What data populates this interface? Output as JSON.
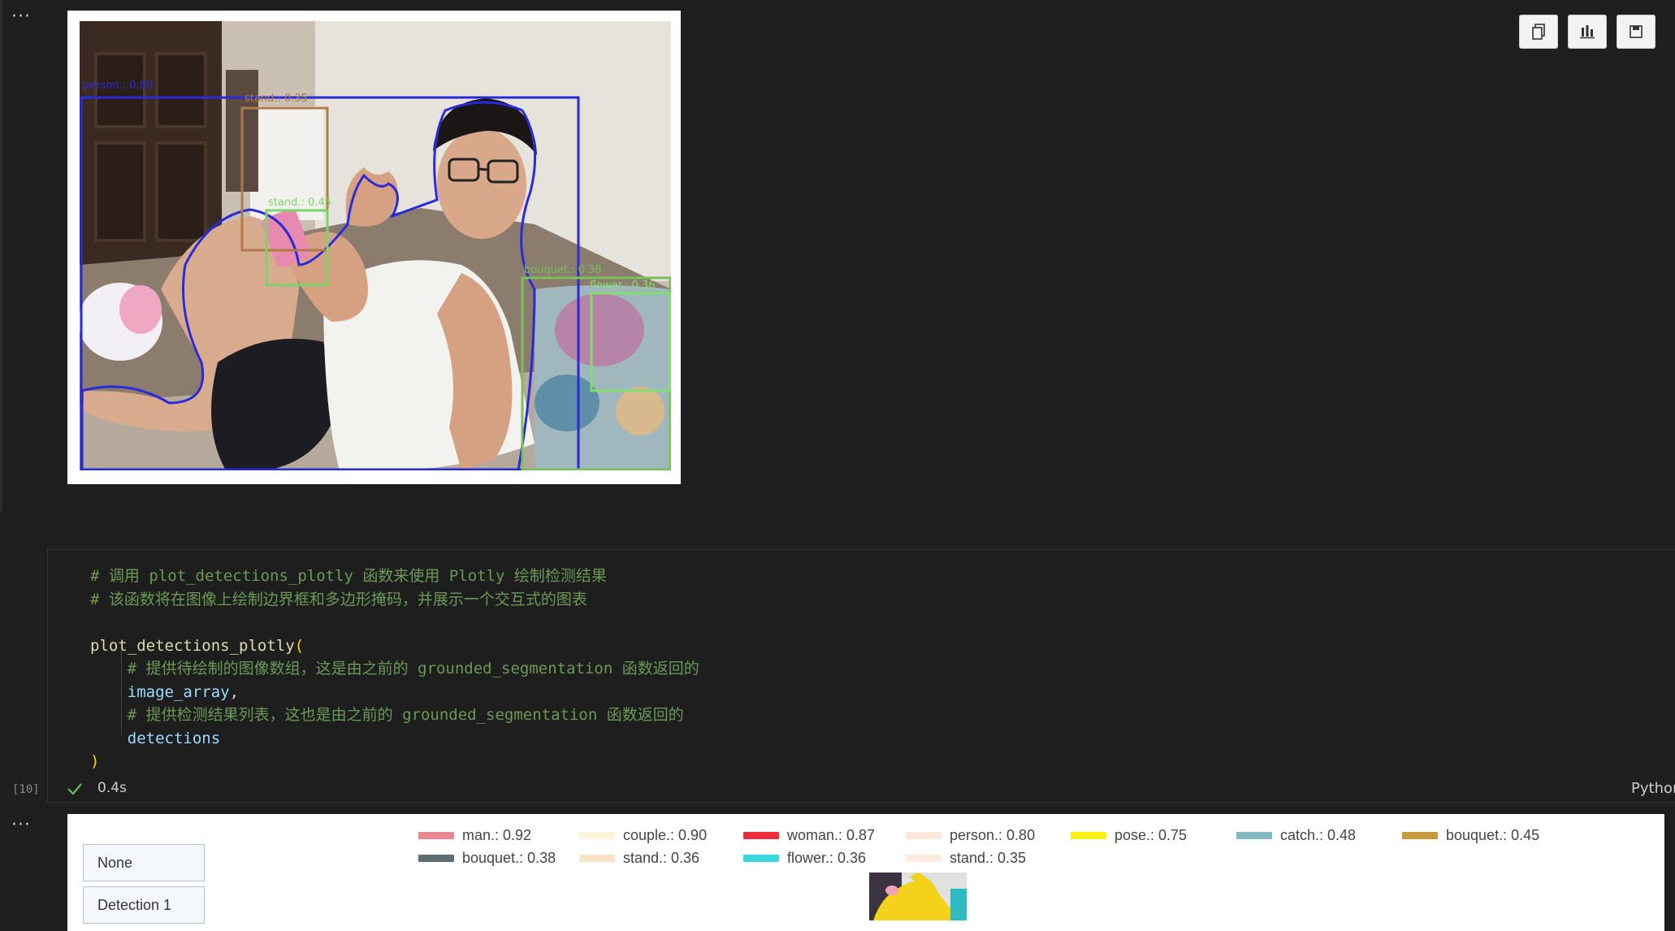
{
  "top_output": {
    "more_label": "···",
    "detections": [
      {
        "label": "person.: 0.80",
        "color": "#2a2ad9"
      },
      {
        "label": "stand.: 0.35",
        "color": "#b07a4a"
      },
      {
        "label": "stand.: 0.45",
        "color": "#7bd36a"
      },
      {
        "label": "bouquet.: 0.38",
        "color": "#7bbf5a"
      },
      {
        "label": "flower.: 0.36",
        "color": "#82dd6c"
      }
    ],
    "toolbar": [
      {
        "name": "copy-icon"
      },
      {
        "name": "bar-chart-icon"
      },
      {
        "name": "save-icon"
      }
    ]
  },
  "code_cell": {
    "lines": [
      {
        "comment": "# 调用 plot_detections_plotly 函数来使用 Plotly 绘制检测结果"
      },
      {
        "comment": "# 该函数将在图像上绘制边界框和多边形掩码，并展示一个交互式的图表"
      },
      {
        "blank": ""
      },
      {
        "fn": "plot_detections_plotly",
        "paren": "("
      },
      {
        "comment": "    # 提供待绘制的图像数组，这是由之前的 grounded_segmentation 函数返回的"
      },
      {
        "var": "    image_array",
        "punct": ","
      },
      {
        "comment": "    # 提供检测结果列表，这也是由之前的 grounded_segmentation 函数返回的"
      },
      {
        "var": "    detections"
      },
      {
        "paren": ")"
      }
    ],
    "execution_count": "[10]",
    "status_time": "0.4s",
    "language": "Python"
  },
  "bottom_output": {
    "more_label": "···",
    "buttons": [
      "None",
      "Detection 1"
    ],
    "legend": [
      {
        "label": "man.: 0.92",
        "color": "#e8878f"
      },
      {
        "label": "couple.: 0.90",
        "color": "#fdf6dc"
      },
      {
        "label": "woman.: 0.87",
        "color": "#ee2c3a"
      },
      {
        "label": "person.: 0.80",
        "color": "#fbe7dc"
      },
      {
        "label": "pose.: 0.75",
        "color": "#f7f012"
      },
      {
        "label": "catch.: 0.48",
        "color": "#83b8bf"
      },
      {
        "label": "bouquet.: 0.45",
        "color": "#c89a3e"
      },
      {
        "label": "bouquet.: 0.38",
        "color": "#5e6e70"
      },
      {
        "label": "stand.: 0.36",
        "color": "#f9e3c6"
      },
      {
        "label": "flower.: 0.36",
        "color": "#3ad8dc"
      },
      {
        "label": "stand.: 0.35",
        "color": "#fbebe1"
      }
    ]
  }
}
